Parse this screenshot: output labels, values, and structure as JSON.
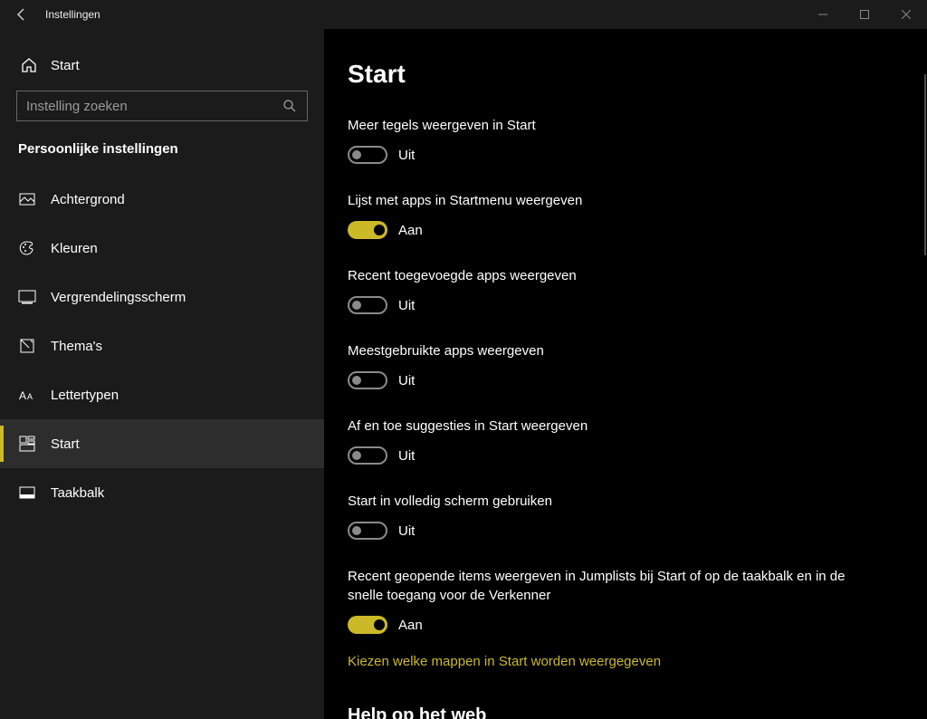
{
  "window": {
    "title": "Instellingen",
    "controls": {
      "minimize": "minimize",
      "maximize": "maximize",
      "close": "close"
    }
  },
  "sidebar": {
    "home_label": "Start",
    "search_placeholder": "Instelling zoeken",
    "category_title": "Persoonlijke instellingen",
    "items": [
      {
        "id": "achtergrond",
        "label": "Achtergrond",
        "icon": "picture-icon"
      },
      {
        "id": "kleuren",
        "label": "Kleuren",
        "icon": "palette-icon"
      },
      {
        "id": "vergrendelingsscherm",
        "label": "Vergrendelingsscherm",
        "icon": "lock-screen-icon"
      },
      {
        "id": "themas",
        "label": "Thema's",
        "icon": "theme-icon"
      },
      {
        "id": "lettertypen",
        "label": "Lettertypen",
        "icon": "font-icon"
      },
      {
        "id": "start",
        "label": "Start",
        "icon": "start-tiles-icon",
        "selected": true
      },
      {
        "id": "taakbalk",
        "label": "Taakbalk",
        "icon": "taskbar-icon"
      }
    ]
  },
  "page": {
    "title": "Start",
    "toggle_on_label": "Aan",
    "toggle_off_label": "Uit",
    "settings": [
      {
        "id": "more-tiles",
        "label": "Meer tegels weergeven in Start",
        "value": false
      },
      {
        "id": "app-list",
        "label": "Lijst met apps in Startmenu weergeven",
        "value": true
      },
      {
        "id": "recent-apps",
        "label": "Recent toegevoegde apps weergeven",
        "value": false
      },
      {
        "id": "most-used",
        "label": "Meestgebruikte apps weergeven",
        "value": false
      },
      {
        "id": "suggestions",
        "label": "Af en toe suggesties in Start weergeven",
        "value": false
      },
      {
        "id": "full-screen",
        "label": "Start in volledig scherm gebruiken",
        "value": false
      },
      {
        "id": "recent-jumplist",
        "label": "Recent geopende items weergeven in Jumplists bij Start of op de taakbalk en in de snelle toegang voor de Verkenner",
        "value": true
      }
    ],
    "folders_link": "Kiezen welke mappen in Start worden weergegeven",
    "help_title": "Help op het web"
  },
  "colors": {
    "accent": "#cbb928",
    "sidebar_bg": "#1b1b1b",
    "content_bg": "#000000"
  }
}
